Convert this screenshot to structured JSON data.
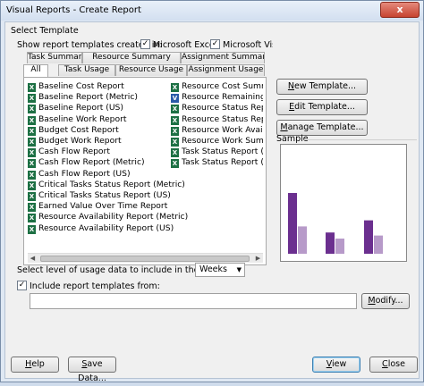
{
  "window": {
    "title": "Visual Reports - Create Report",
    "close_glyph": "x"
  },
  "select_template": {
    "group_label": "Select Template",
    "show_label": "Show report templates created in:",
    "excel_label": "Microsoft Excel",
    "visio_label": "Microsoft Visio",
    "excel_checked": true,
    "visio_checked": true
  },
  "tabs": {
    "row_top": [
      "Task Summary",
      "Resource Summary",
      "Assignment Summary"
    ],
    "row_bottom": [
      "All",
      "Task Usage",
      "Resource Usage",
      "Assignment Usage"
    ],
    "active": "All"
  },
  "reports": {
    "left_column": [
      "Baseline Cost Report",
      "Baseline Report (Metric)",
      "Baseline Report (US)",
      "Baseline Work Report",
      "Budget Cost Report",
      "Budget Work Report",
      "Cash Flow Report",
      "Cash Flow Report (Metric)",
      "Cash Flow Report (US)",
      "Critical Tasks Status Report (Metric)",
      "Critical Tasks Status Report (US)",
      "Earned Value Over Time Report",
      "Resource Availability Report (Metric)",
      "Resource Availability Report (US)"
    ],
    "right_column": [
      "Resource Cost Summ",
      "Resource Remaining W",
      "Resource Status Repo",
      "Resource Status Repo",
      "Resource Work Availa",
      "Resource Work Summ",
      "Task Status Report (M",
      "Task Status Report (US"
    ],
    "icon_excel": "X",
    "icon_visio": "V",
    "left_icons": [
      "excel",
      "excel",
      "excel",
      "excel",
      "excel",
      "excel",
      "excel",
      "excel",
      "excel",
      "excel",
      "excel",
      "excel",
      "excel",
      "excel"
    ],
    "right_icons": [
      "excel",
      "visio",
      "excel",
      "excel",
      "excel",
      "excel",
      "excel",
      "excel"
    ]
  },
  "actions": {
    "new_template": "New Template...",
    "edit_template": "Edit Template...",
    "manage_template": "Manage Template..."
  },
  "sample": {
    "label": "Sample",
    "chart_data": {
      "type": "bar",
      "series": [
        {
          "values": [
            1.0,
            0.35,
            0.55
          ]
        },
        {
          "values": [
            0.45,
            0.25,
            0.3
          ]
        }
      ],
      "colors": [
        "#6b2f8f",
        "#b79ac9"
      ]
    }
  },
  "usage": {
    "label": "Select level of usage data to include in the report:",
    "value": "Weeks"
  },
  "include": {
    "label": "Include report templates from:",
    "checked": true,
    "path": "",
    "modify_label": "Modify..."
  },
  "footer": {
    "help": "Help",
    "save_data": "Save Data...",
    "view": "View",
    "close": "Close"
  }
}
